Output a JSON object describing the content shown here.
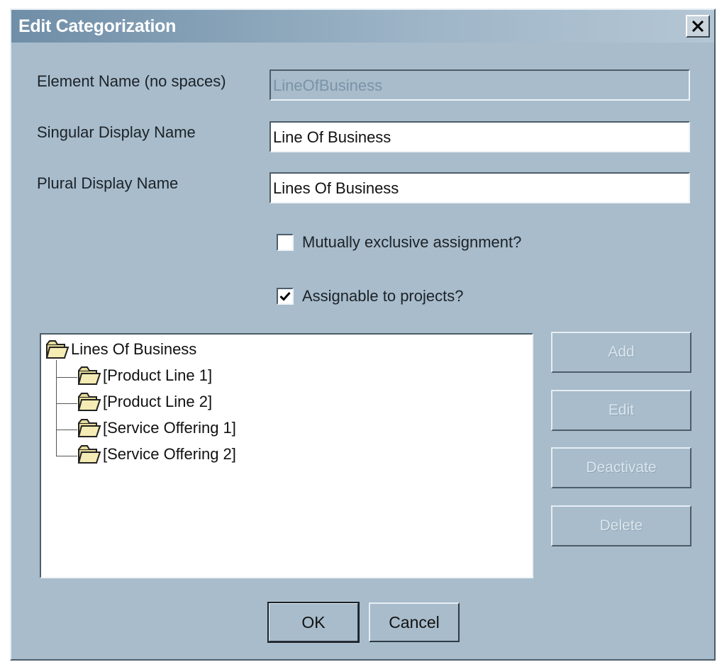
{
  "window": {
    "title": "Edit Categorization"
  },
  "form": {
    "element_name_label": "Element Name (no spaces)",
    "element_name_value": "LineOfBusiness",
    "singular_label": "Singular Display Name",
    "singular_value": "Line Of Business",
    "plural_label": "Plural Display Name",
    "plural_value": "Lines Of Business",
    "mutually_exclusive_label": "Mutually exclusive assignment?",
    "mutually_exclusive_checked": false,
    "assignable_label": "Assignable to projects?",
    "assignable_checked": true
  },
  "tree": {
    "root": "Lines Of Business",
    "children": [
      "[Product Line 1]",
      "[Product Line 2]",
      "[Service Offering 1]",
      "[Service Offering 2]"
    ]
  },
  "actions": {
    "add": "Add",
    "edit": "Edit",
    "deactivate": "Deactivate",
    "delete": "Delete"
  },
  "footer": {
    "ok": "OK",
    "cancel": "Cancel"
  },
  "colors": {
    "dialog_bg": "#a8bccb",
    "title_gradient_start": "#6f8ea7"
  },
  "icons": {
    "folder": "folder-icon",
    "close": "close-icon",
    "check": "checkmark-icon"
  }
}
